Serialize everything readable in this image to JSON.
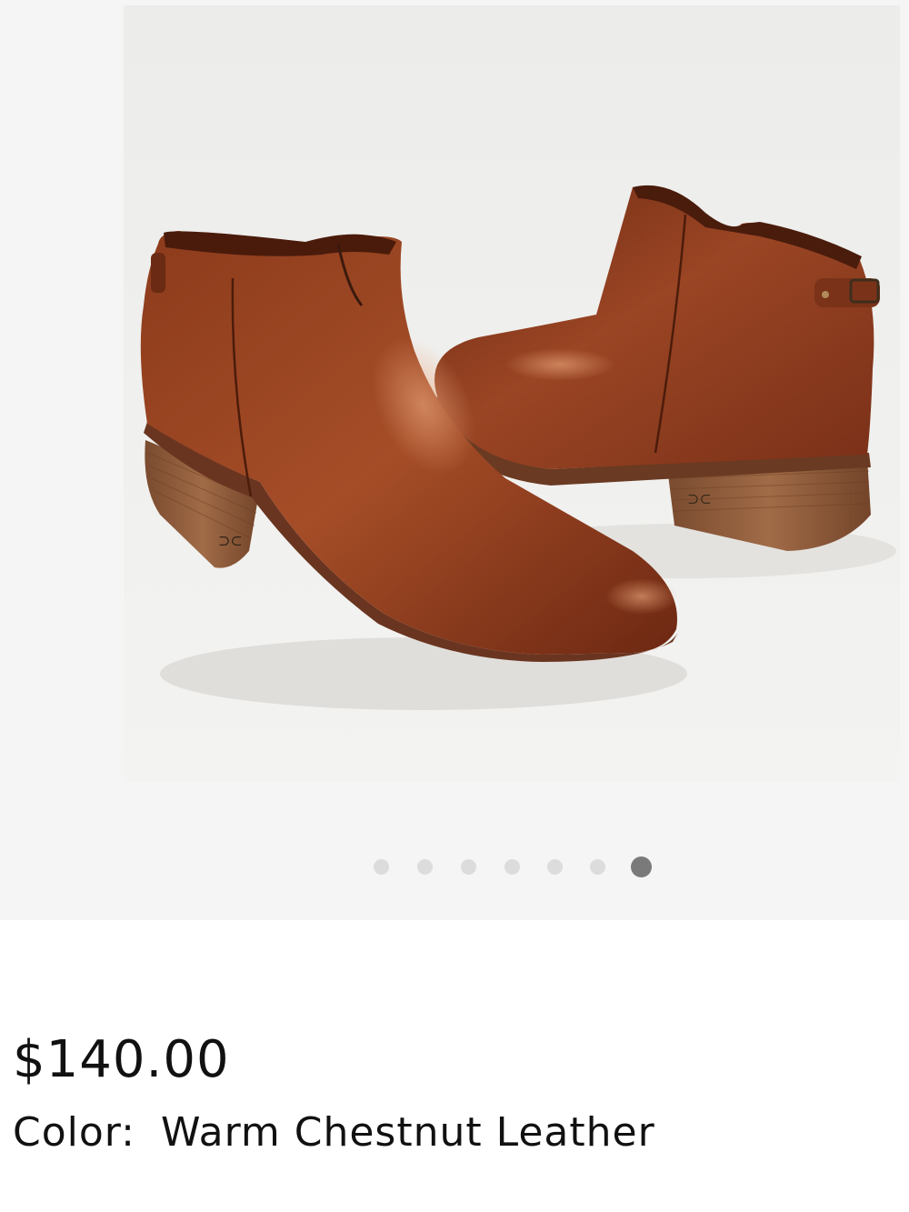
{
  "product": {
    "image_alt": "Warm Chestnut Leather ankle boots",
    "price": "$140.00",
    "color_label": "Color:",
    "color_value": "Warm Chestnut Leather"
  },
  "gallery": {
    "slide_count": 7,
    "active_index": 6
  },
  "colors": {
    "page_background": "#ffffff",
    "gallery_background": "#f5f5f5",
    "dot_inactive": "#dcdcdc",
    "dot_active": "#7a7a7a",
    "leather": "#8a3a1d",
    "heel_wood": "#8b5a3c"
  }
}
